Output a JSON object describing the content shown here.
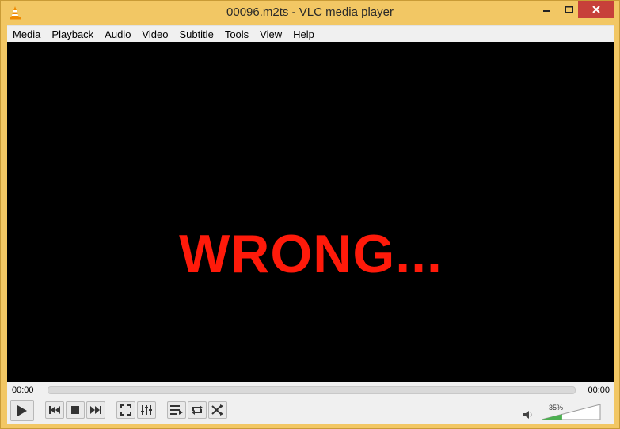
{
  "window": {
    "title": "00096.m2ts - VLC media player"
  },
  "menu": {
    "items": [
      "Media",
      "Playback",
      "Audio",
      "Video",
      "Subtitle",
      "Tools",
      "View",
      "Help"
    ]
  },
  "video": {
    "overlay_text": "WRONG..."
  },
  "playback": {
    "elapsed": "00:00",
    "total": "00:00",
    "progress": 0
  },
  "volume": {
    "percent_label": "35%",
    "level": 0.35
  },
  "icons": {
    "app": "vlc-cone-icon",
    "minimize": "minimize-icon",
    "maximize": "maximize-icon",
    "close": "close-icon",
    "play": "play-icon",
    "previous": "previous-icon",
    "stop": "stop-icon",
    "next": "next-icon",
    "fullscreen": "fullscreen-icon",
    "extended_settings": "equalizer-icon",
    "playlist": "playlist-icon",
    "loop": "loop-icon",
    "shuffle": "shuffle-icon",
    "volume": "speaker-icon"
  },
  "colors": {
    "frame": "#f2c764",
    "close_button": "#c7403a",
    "overlay_text": "#ff1a0a",
    "volume_fill": "#4caf50"
  }
}
